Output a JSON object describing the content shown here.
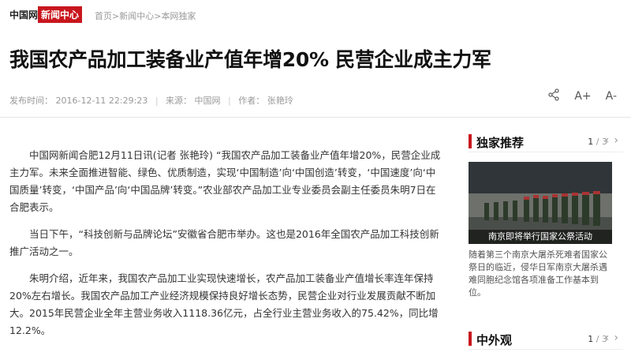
{
  "header": {
    "logo": "中国网",
    "section": "新闻中心",
    "breadcrumb": [
      "首页",
      "新闻中心",
      "本网独家"
    ]
  },
  "article": {
    "title": "我国农产品加工装备业产值年增20% 民营企业成主力军",
    "meta": {
      "time_label": "发布时间：",
      "time": "2016-12-11 22:29:23",
      "source_label": "来源：",
      "source": "中国网",
      "author_label": "作者：",
      "author": "张艳玲"
    },
    "paragraphs": [
      "中国网新闻合肥12月11日讯(记者 张艳玲) “我国农产品加工装备业产值年增20%，民营企业成主力军。未来全面推进智能、绿色、优质制造，实现‘中国制造’向‘中国创造’转变，‘中国速度’向‘中国质量’转变，‘中国产品’向‘中国品牌’转变。”农业部农产品加工业专业委员会副主任委员朱明7日在合肥表示。",
      "当日下午，“科技创新与品牌论坛”安徽省合肥市举办。这也是2016年全国农产品加工科技创新推广活动之一。",
      "朱明介绍，近年来，我国农产品加工业实现快速增长，农产品加工装备业产值增长率连年保持20%左右增长。我国农产品加工产业经济规模保持良好增长态势，民营企业对行业发展贡献不断加大。2015年民营企业全年主营业务收入1118.36亿元，占全行业主营业务收入的75.42%，同比增12.2%。"
    ]
  },
  "toolbar": {
    "share_icon": "share-icon",
    "font_larger": "A+",
    "font_smaller": "A-"
  },
  "sidebar": {
    "exclusive": {
      "label": "独家推荐",
      "page_current": "1",
      "page_total": "/ 3",
      "photo_caption": "南京即将举行国家公祭活动",
      "description": "随着第三个南京大屠杀死难者国家公祭日的临近，侵华日军南京大屠杀遇难同胞纪念馆各项准备工作基本到位。"
    },
    "world": {
      "label": "中外观",
      "page_current": "1",
      "page_total": "/ 3"
    }
  },
  "colors": {
    "accent": "#c8161d"
  }
}
